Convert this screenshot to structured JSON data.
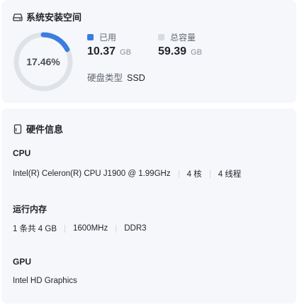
{
  "storage": {
    "title": "系统安装空间",
    "percent_label": "17.46%",
    "used_fraction": 0.1746,
    "used_label": "已用",
    "used_value": "10.37",
    "used_unit": "GB",
    "total_label": "总容量",
    "total_value": "59.39",
    "total_unit": "GB",
    "disk_type_label": "硬盘类型",
    "disk_type_value": "SSD",
    "colors": {
      "used": "#3a7ee0",
      "track": "#dfe3e8",
      "total": "#d8dce1"
    }
  },
  "hardware": {
    "title": "硬件信息",
    "cpu": {
      "label": "CPU",
      "model": "Intel(R) Celeron(R) CPU J1900 @ 1.99GHz",
      "cores": "4 核",
      "threads": "4 线程"
    },
    "memory": {
      "label": "运行内存",
      "size": "1 条共 4 GB",
      "frequency": "1600MHz",
      "type": "DDR3"
    },
    "gpu": {
      "label": "GPU",
      "model": "Intel HD Graphics"
    }
  },
  "icons": {
    "storage": "disk-icon",
    "hardware": "phone-icon"
  }
}
